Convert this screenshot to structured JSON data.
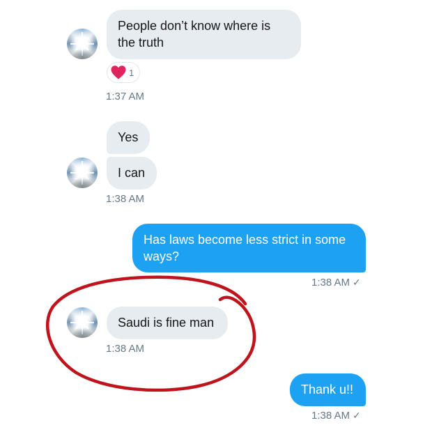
{
  "messages": [
    {
      "direction": "received",
      "text": "People don’t know where is the truth"
    },
    {
      "direction": "received",
      "text": "Yes"
    },
    {
      "direction": "received",
      "text": "I can"
    },
    {
      "direction": "sent",
      "text": "Has laws become less strict in some ways?"
    },
    {
      "direction": "received",
      "text": "Saudi is fine man"
    },
    {
      "direction": "sent",
      "text": "Thank u!!"
    }
  ],
  "reaction": {
    "icon": "heart-icon",
    "count": "1",
    "color": "#e0245e"
  },
  "timestamps": [
    "1:37 AM",
    "1:38 AM",
    "1:38 AM",
    "1:38 AM",
    "1:38 AM"
  ],
  "colors": {
    "sent_bubble": "#1da1f2",
    "received_bubble": "#e6ecf0",
    "timestamp": "#657786",
    "annotation_circle": "#c0141c"
  }
}
